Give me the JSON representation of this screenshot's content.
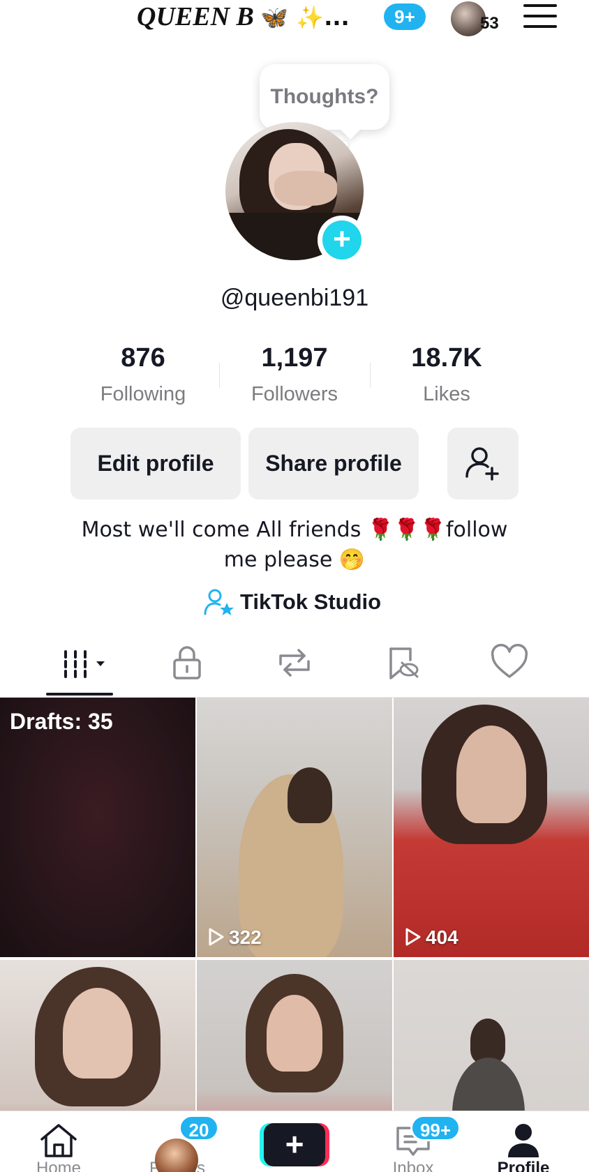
{
  "header": {
    "title": "QUEEN B",
    "title_emojis": "🦋 ✨...",
    "notifications_badge": "9+",
    "account_count": "53"
  },
  "profile": {
    "bubble_text": "Thoughts?",
    "username": "@queenbi191",
    "stats": [
      {
        "value": "876",
        "label": "Following"
      },
      {
        "value": "1,197",
        "label": "Followers"
      },
      {
        "value": "18.7K",
        "label": "Likes"
      }
    ],
    "edit_label": "Edit profile",
    "share_label": "Share profile",
    "bio_line1": "Most we'll come All friends 🌹🌹🌹follow",
    "bio_line2": "me please 🤭",
    "studio_label": "TikTok Studio"
  },
  "tabs": [
    "videos-grid",
    "private",
    "reposts",
    "hidden",
    "liked"
  ],
  "grid": {
    "drafts_label": "Drafts: 35",
    "videos": [
      {
        "views": ""
      },
      {
        "views": "322"
      },
      {
        "views": "404"
      },
      {
        "views": ""
      },
      {
        "views": ""
      },
      {
        "views": ""
      }
    ]
  },
  "nav": {
    "items": [
      {
        "label": "Home",
        "icon": "home-icon"
      },
      {
        "label": "Friends",
        "icon": "friends-avatar"
      },
      {
        "label": "",
        "icon": "create-icon"
      },
      {
        "label": "Inbox",
        "icon": "inbox-icon"
      },
      {
        "label": "Profile",
        "icon": "profile-icon"
      }
    ],
    "friends_badge": "20",
    "inbox_badge": "99+"
  },
  "colors": {
    "accent": "#20d5ec",
    "badge": "#20b3f0",
    "text": "#161823",
    "muted": "#7c7c80"
  }
}
